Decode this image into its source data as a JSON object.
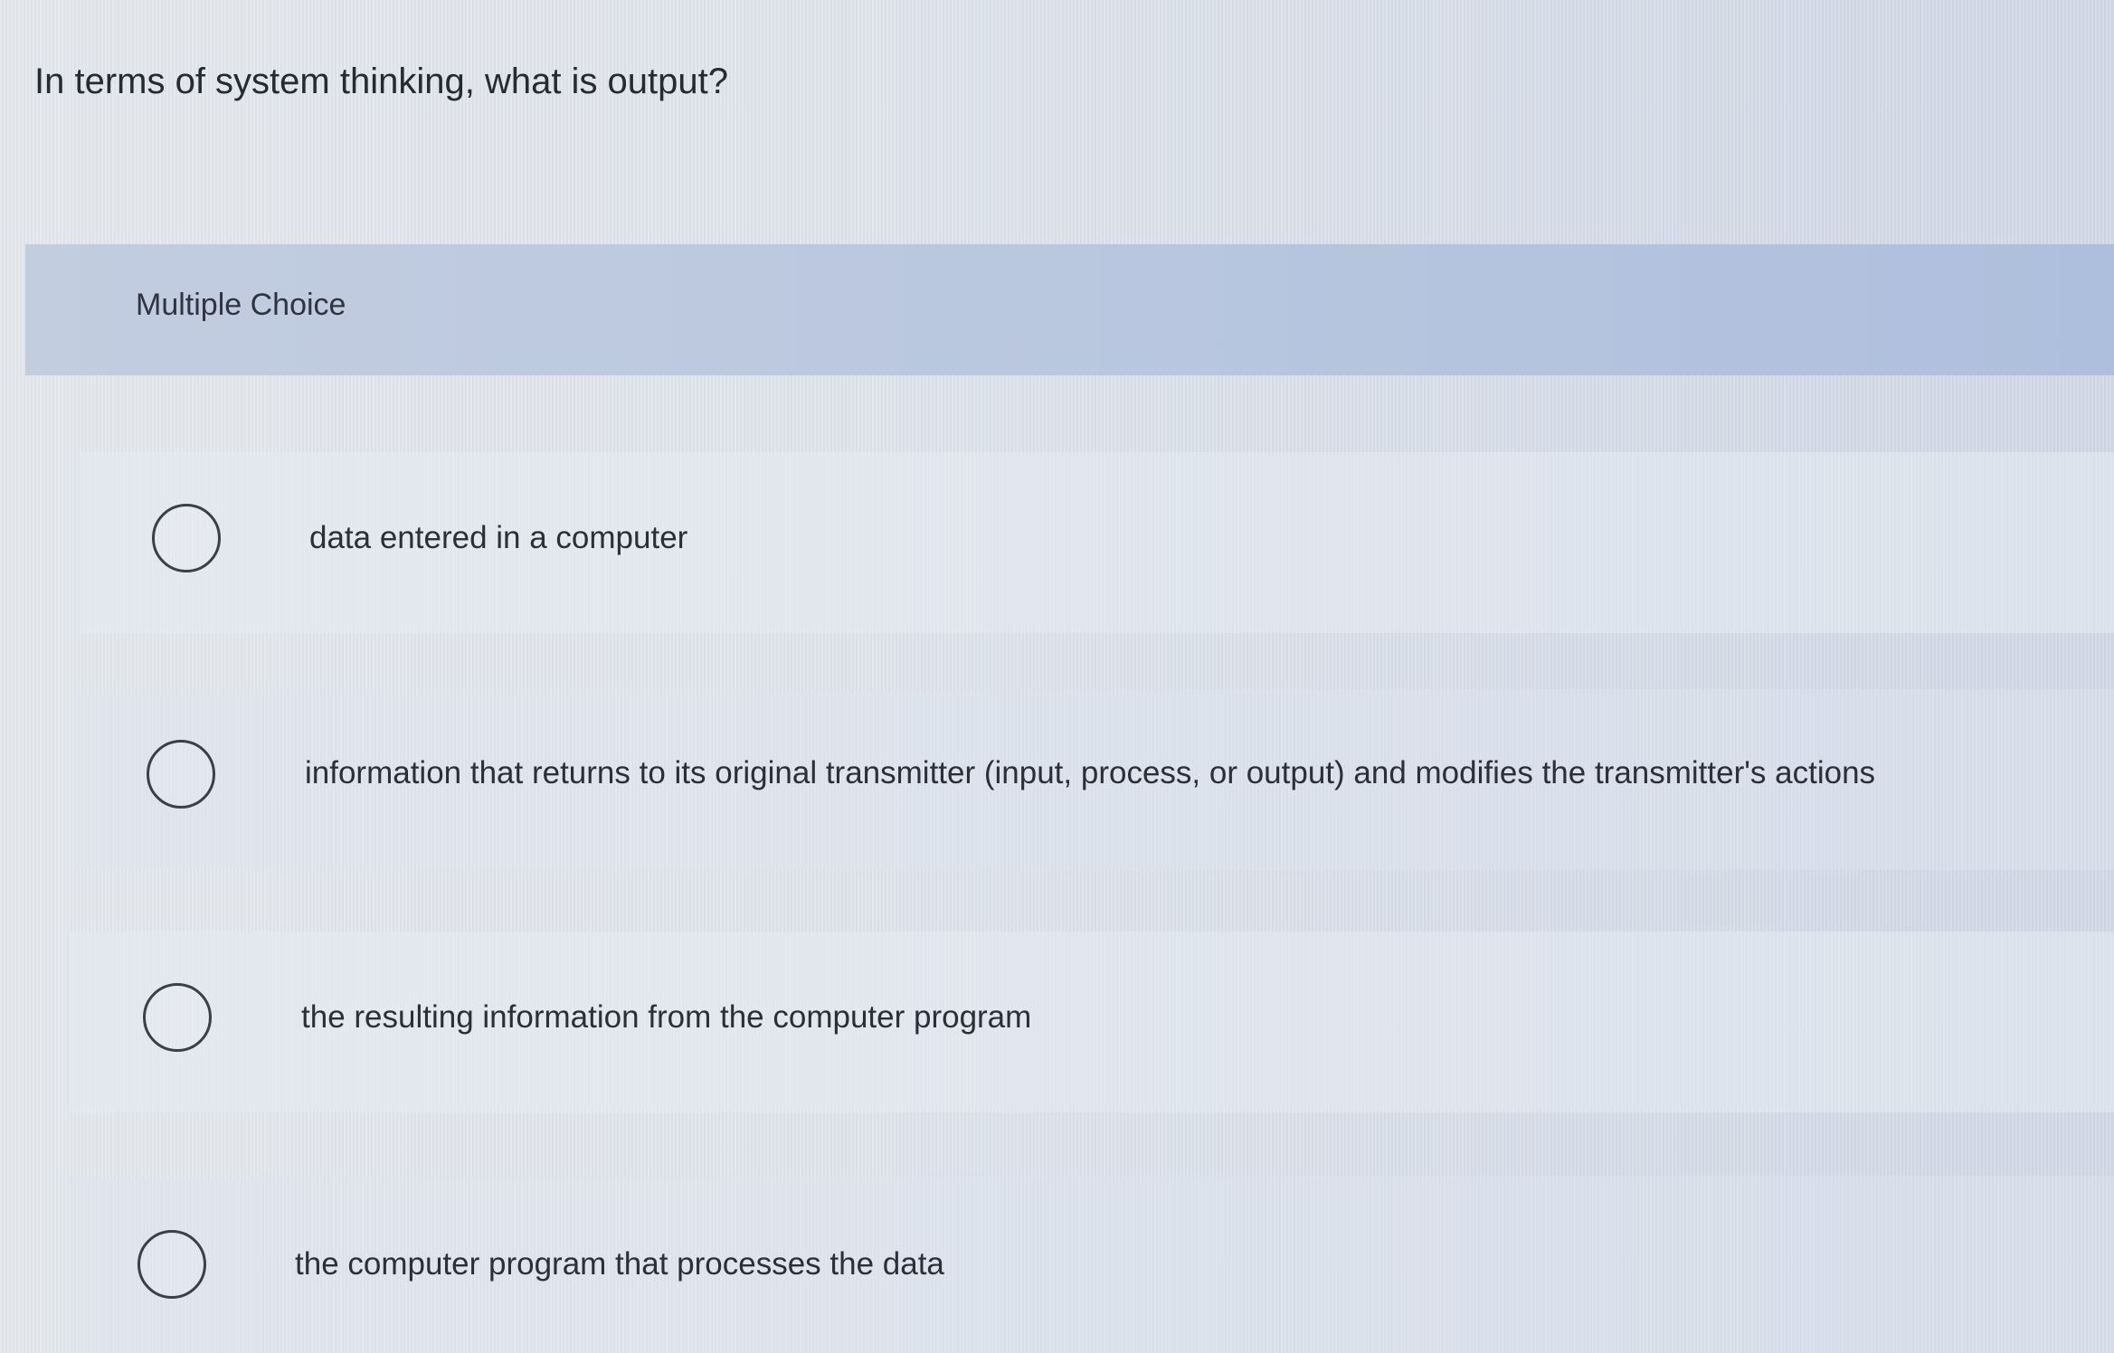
{
  "question": {
    "text": "In terms of system thinking, what is output?"
  },
  "question_type": {
    "label": "Multiple Choice"
  },
  "options": [
    {
      "label": "data entered in a computer",
      "selected": false
    },
    {
      "label": "information that returns to its original transmitter (input, process, or output) and modifies the transmitter's actions",
      "selected": false
    },
    {
      "label": "the resulting information from the computer program",
      "selected": false
    },
    {
      "label": "the computer program that processes the data",
      "selected": false
    }
  ]
}
